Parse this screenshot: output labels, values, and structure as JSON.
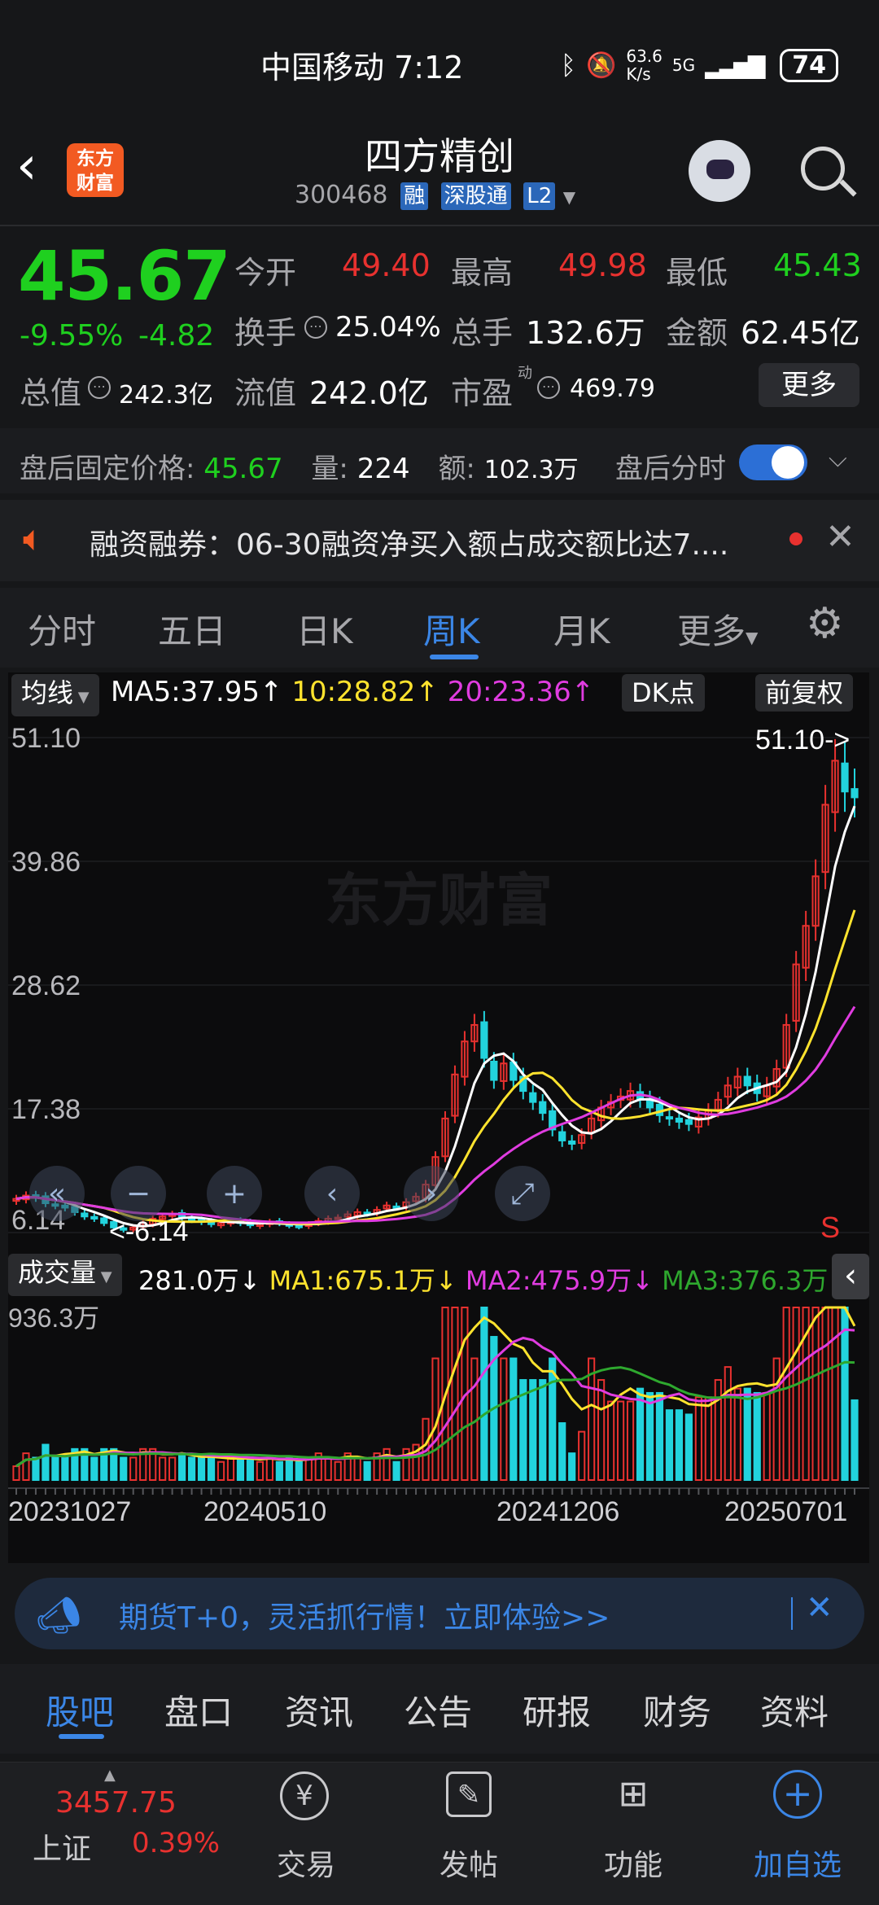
{
  "status_bar": {
    "carrier_time": "中国移动 7:12",
    "net_speed": "63.6\nK/s",
    "net_speed_top": "63.6",
    "net_speed_bottom": "K/s",
    "network": "5G",
    "battery": "74"
  },
  "header": {
    "logo_line1": "东方",
    "logo_line2": "财富",
    "title": "四方精创",
    "code": "300468",
    "tags": [
      "融",
      "深股通",
      "L2"
    ]
  },
  "quote": {
    "price": "45.67",
    "pct": "-9.55%",
    "change": "-4.82",
    "open_label": "今开",
    "open": "49.40",
    "high_label": "最高",
    "high": "49.98",
    "low_label": "最低",
    "low": "45.43",
    "turnover_label": "换手",
    "turnover": "25.04%",
    "volume_label": "总手",
    "volume": "132.6万",
    "amount_label": "金额",
    "amount": "62.45亿",
    "mktcap_label": "总值",
    "mktcap": "242.3亿",
    "float_label": "流值",
    "float": "242.0亿",
    "pe_label": "市盈",
    "pe_sup": "动",
    "pe": "469.79",
    "more_label": "更多"
  },
  "after_hours": {
    "price_label": "盘后固定价格:",
    "price": "45.67",
    "vol_label": "量:",
    "vol": "224",
    "amt_label": "额:",
    "amt": "102.3万",
    "toggle_label": "盘后分时"
  },
  "notice": {
    "text": "融资融券：06-30融资净买入额占成交额比达7...."
  },
  "chart_tabs": [
    "分时",
    "五日",
    "日K",
    "周K",
    "月K",
    "更多"
  ],
  "chart_tab_active": 3,
  "ma": {
    "selector": "均线",
    "ma5": "MA5:37.95↑",
    "ma10": "10:28.82↑",
    "ma20": "20:23.36↑",
    "dk_label": "DK点",
    "adjust_label": "前复权"
  },
  "volume_bar": {
    "selector": "成交量",
    "vol": "281.0万↓",
    "ma1": "MA1:675.1万↓",
    "ma2": "MA2:475.9万↓",
    "ma3": "MA3:376.3万↑",
    "top_label": "936.3万"
  },
  "chart_data": {
    "type": "candlestick",
    "y_ticks": [
      "51.10",
      "39.86",
      "28.62",
      "17.38",
      "6.14"
    ],
    "ylim": [
      6.14,
      51.1
    ],
    "max_marker": "51.10->",
    "min_marker": "<-6.14",
    "x_ticks": [
      "20231027",
      "20240510",
      "20241206",
      "20250701"
    ],
    "watermark": "东方财富",
    "sell_mark": "S",
    "ma5_color": "#ffffff",
    "ma10_color": "#ffe32e",
    "ma20_color": "#e03ce0",
    "up_color": "#e8312f",
    "down_color": "#22d3dd",
    "close": [
      9.2,
      9.5,
      9.3,
      8.8,
      8.6,
      8.4,
      8.0,
      7.6,
      7.4,
      7.0,
      6.6,
      6.4,
      6.6,
      7.0,
      7.4,
      7.6,
      7.8,
      7.5,
      7.3,
      7.1,
      6.9,
      7.0,
      7.2,
      7.0,
      6.8,
      6.9,
      7.1,
      7.0,
      6.8,
      6.7,
      6.9,
      7.2,
      7.4,
      7.5,
      7.8,
      8.0,
      7.9,
      8.2,
      8.6,
      8.5,
      8.9,
      9.4,
      10.5,
      13.0,
      16.5,
      20.5,
      23.5,
      25.0,
      22.0,
      20.0,
      21.5,
      20.0,
      19.0,
      18.0,
      17.0,
      15.5,
      14.5,
      14.2,
      15.0,
      16.5,
      17.5,
      18.0,
      18.5,
      19.0,
      18.2,
      17.5,
      16.8,
      16.5,
      16.2,
      16.0,
      16.6,
      17.2,
      18.2,
      19.5,
      20.3,
      19.5,
      18.8,
      19.5,
      21.0,
      25.0,
      30.5,
      34.0,
      38.5,
      45.0,
      49.0,
      46.2,
      45.67
    ]
  },
  "ad_banner": {
    "text": "期货T+0，灵活抓行情！立即体验>>"
  },
  "info_tabs": [
    "股吧",
    "盘口",
    "资讯",
    "公告",
    "研报",
    "财务",
    "资料"
  ],
  "info_tab_active": 0,
  "bottom_nav": {
    "index_value": "3457.75",
    "index_name": "上证",
    "index_pct": "0.39%",
    "items": [
      "交易",
      "发帖",
      "功能",
      "加自选"
    ]
  }
}
